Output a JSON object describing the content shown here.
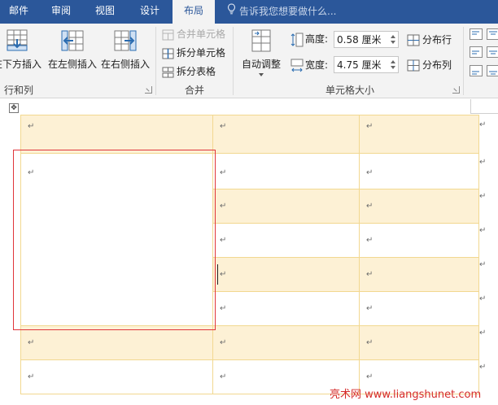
{
  "tabs": [
    {
      "label": "邮件",
      "active": false
    },
    {
      "label": "审阅",
      "active": false
    },
    {
      "label": "视图",
      "active": false
    },
    {
      "label": "设计",
      "active": false
    },
    {
      "label": "布局",
      "active": true
    }
  ],
  "tell_me": {
    "placeholder": "告诉我您想要做什么...",
    "icon": "lightbulb-icon"
  },
  "ribbon": {
    "rows_columns": {
      "label": "行和列",
      "insert_below": "在下方插入",
      "insert_left": "在左侧插入",
      "insert_right": "在右侧插入"
    },
    "merge": {
      "label": "合并",
      "merge_cells": "合并单元格",
      "split_cells": "拆分单元格",
      "split_table": "拆分表格"
    },
    "cell_size": {
      "label": "单元格大小",
      "autofit": "自动调整",
      "height_label": "高度:",
      "height_value": "0.58 厘米",
      "width_label": "宽度:",
      "width_value": "4.75 厘米",
      "distribute_rows": "分布行",
      "distribute_cols": "分布列"
    }
  },
  "document": {
    "paragraph_mark": "↵",
    "move_handle": "✥"
  },
  "watermark": "亮术网 www.liangshunet.com",
  "colors": {
    "title_bar": "#2b579a",
    "ribbon_bg": "#f3f3f3",
    "table_border": "#f2d890",
    "band_fill": "#fdf1d5",
    "highlight": "#e0363b",
    "watermark": "#d52b2b"
  }
}
